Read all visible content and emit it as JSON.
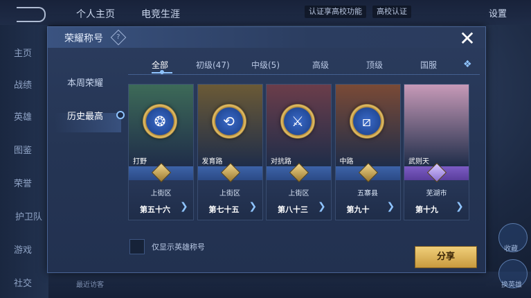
{
  "background": {
    "top_tabs": [
      "个人主页",
      "电竞生涯"
    ],
    "top_pills": [
      "认证享高校功能",
      "高校认证"
    ],
    "settings_label": "设置",
    "left_nav": [
      "主页",
      "战绩",
      "英雄",
      "图鉴",
      "荣誉",
      "护卫队",
      "游戏",
      "社交"
    ],
    "bottom_text": "最近访客",
    "right_labels": [
      "收藏",
      "换英雄"
    ]
  },
  "modal": {
    "title": "荣耀称号",
    "help_symbol": "?",
    "close_symbol": "✕",
    "side_tabs": [
      "本周荣耀",
      "历史最高"
    ],
    "active_side_tab": "历史最高",
    "categories": [
      "全部",
      "初级(47)",
      "中级(5)",
      "高级",
      "顶级",
      "国服"
    ],
    "active_category": "全部",
    "cards": [
      {
        "role": "打野",
        "region": "上街区",
        "rank": "第五十六",
        "emblem": "dragon-icon",
        "art": "#3d6a58",
        "ribbon": "blue"
      },
      {
        "role": "发育路",
        "region": "上街区",
        "rank": "第七十五",
        "emblem": "circle-arrow-icon",
        "art": "#6b5a36",
        "ribbon": "blue"
      },
      {
        "role": "对抗路",
        "region": "上街区",
        "rank": "第八十三",
        "emblem": "crossed-swords-icon",
        "art": "#6b3d4a",
        "ribbon": "blue"
      },
      {
        "role": "中路",
        "region": "五寨县",
        "rank": "第九十",
        "emblem": "slash-icon",
        "art": "#7a4a36",
        "ribbon": "blue"
      },
      {
        "role": "武则天",
        "region": "芜湖市",
        "rank": "第十九",
        "emblem": "hero-portrait",
        "art": "#c79ab8",
        "ribbon": "purple"
      }
    ],
    "checkbox_label": "仅显示英雄称号",
    "share_label": "分享"
  }
}
